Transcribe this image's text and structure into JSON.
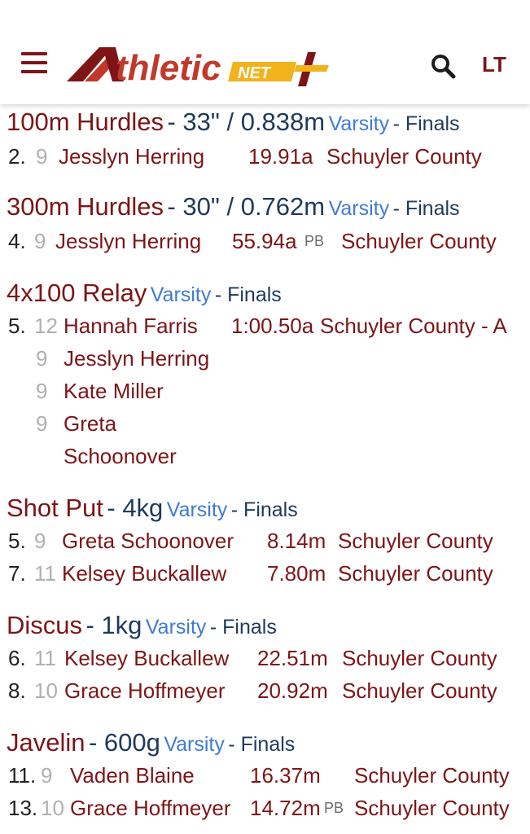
{
  "header": {
    "logo_text_main": "thletic",
    "logo_text_net": "NET",
    "language": "LT"
  },
  "events": [
    {
      "name": "100m Hurdles",
      "spec": "33\" / 0.838m",
      "level": "Varsity",
      "round": "Finals",
      "rows": [
        {
          "place": "2.",
          "grade": "9",
          "athlete": "Jesslyn Herring",
          "mark": "19.91a",
          "pb": "",
          "team": "Schuyler County"
        }
      ]
    },
    {
      "name": "300m Hurdles",
      "spec": "30\" / 0.762m",
      "level": "Varsity",
      "round": "Finals",
      "rows": [
        {
          "place": "4.",
          "grade": "9",
          "athlete": "Jesslyn Herring",
          "mark": "55.94a",
          "pb": "PB",
          "team": "Schuyler County"
        }
      ]
    },
    {
      "name": "4x100 Relay",
      "spec": "",
      "level": "Varsity",
      "round": "Finals",
      "rows": [
        {
          "place": "5.",
          "grade": "12",
          "athlete": "Hannah Farris",
          "mark": "1:00.50a",
          "pb": "",
          "team": "Schuyler County - A"
        },
        {
          "place": "",
          "grade": "9",
          "athlete": "Jesslyn Herring",
          "mark": "",
          "pb": "",
          "team": ""
        },
        {
          "place": "",
          "grade": "9",
          "athlete": "Kate Miller",
          "mark": "",
          "pb": "",
          "team": ""
        },
        {
          "place": "",
          "grade": "9",
          "athlete": "Greta",
          "mark": "",
          "pb": "",
          "team": ""
        },
        {
          "place": "",
          "grade": "",
          "athlete": "Schoonover",
          "mark": "",
          "pb": "",
          "team": ""
        }
      ]
    },
    {
      "name": "Shot Put",
      "spec": "4kg",
      "level": "Varsity",
      "round": "Finals",
      "rows": [
        {
          "place": "5.",
          "grade": "9",
          "athlete": "Greta Schoonover",
          "mark": "8.14m",
          "pb": "",
          "team": "Schuyler County"
        },
        {
          "place": "7.",
          "grade": "11",
          "athlete": "Kelsey Buckallew",
          "mark": "7.80m",
          "pb": "",
          "team": "Schuyler County"
        }
      ]
    },
    {
      "name": "Discus",
      "spec": "1kg",
      "level": "Varsity",
      "round": "Finals",
      "rows": [
        {
          "place": "6.",
          "grade": "11",
          "athlete": "Kelsey Buckallew",
          "mark": "22.51m",
          "pb": "",
          "team": "Schuyler County"
        },
        {
          "place": "8.",
          "grade": "10",
          "athlete": "Grace Hoffmeyer",
          "mark": "20.92m",
          "pb": "",
          "team": "Schuyler County"
        }
      ]
    },
    {
      "name": "Javelin",
      "spec": "600g",
      "level": "Varsity",
      "round": "Finals",
      "rows": [
        {
          "place": "11.",
          "grade": "9",
          "athlete": "Vaden Blaine",
          "mark": "16.37m",
          "pb": "",
          "team": "Schuyler County"
        },
        {
          "place": "13.",
          "grade": "10",
          "athlete": "Grace Hoffmeyer",
          "mark": "14.72m",
          "pb": "PB",
          "team": "Schuyler County"
        }
      ]
    }
  ],
  "colors": {
    "brand_maroon": "#7d1517",
    "navy": "#1e3a5c",
    "level_blue": "#3f7bd3",
    "logo_gold": "#f2b21b"
  }
}
